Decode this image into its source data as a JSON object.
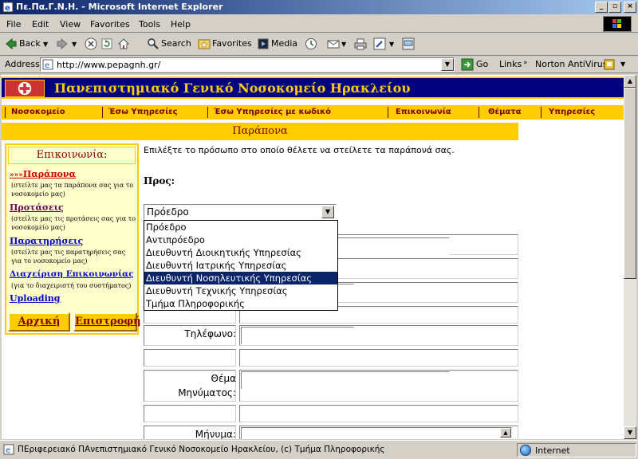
{
  "window": {
    "title": "Πε.Πα.Γ.Ν.Η. - Microsoft Internet Explorer"
  },
  "menubar": {
    "items": [
      "File",
      "Edit",
      "View",
      "Favorites",
      "Tools",
      "Help"
    ]
  },
  "toolbar": {
    "back": "Back",
    "search": "Search",
    "favorites": "Favorites",
    "media": "Media"
  },
  "address": {
    "label": "Address",
    "url": "http://www.pepagnh.gr/",
    "go": "Go",
    "links": "Links",
    "norton": "Norton AntiVirus"
  },
  "site": {
    "banner_title": "Πανεπιστημιακό Γενικό Νοσοκομείο Ηρακλείου",
    "nav": [
      "Νοσοκομείο",
      "Έσω Υπηρεσίες",
      "Έσω Υπηρεσίες με κωδικό",
      "Επικοινωνία",
      "Θέματα",
      "Υπηρεσίες"
    ],
    "page_header": "Παράπονα"
  },
  "sidebar": {
    "title": "Επικοινωνία:",
    "items": [
      {
        "arrow": "»»»",
        "label": "Παράπονα",
        "desc": "(στείλτε μας τα παράπονα σας για το νοσοκομείο μας)"
      },
      {
        "label": "Προτάσεις",
        "desc": "(στείλτε μας τις προτάσεις σας για το νοσοκομείο μας)"
      },
      {
        "label": "Παρατηρήσεις",
        "desc": "(στείλτε μας τις παρατηρήσεις σας για το νοσοκομείο μας)"
      },
      {
        "label": "Διαχείριση Επικοινωνίας",
        "desc": "(για το διαχειριστή του συστήματος)"
      },
      {
        "label": "Uploading"
      }
    ],
    "home_button": "Αρχική",
    "return_button": "Επιστροφή"
  },
  "form": {
    "intro": "Επιλέξτε το πρόσωπο στο οποίο θέλετε να στείλετε τα παράπονά σας.",
    "to_label": "Προς:",
    "selected": "Πρόεδρο",
    "options": [
      "Πρόεδρο",
      "Αντιπρόεδρο",
      "Διευθυντή Διοικητικής Υπηρεσίας",
      "Διευθυντή Ιατρικής Υπηρεσίας",
      "Διευθυντή Νοσηλευτικής Υπηρεσίας",
      "Διευθυντή Τεχνικής Υπηρεσίας",
      "Τμήμα Πληροφορικής"
    ],
    "highlighted_option": "Διευθυντή Νοσηλευτικής Υπηρεσίας",
    "phone_label": "Τηλέφωνο:",
    "subject_label_1": "Θέμα",
    "subject_label_2": "Μηνύματος:",
    "message_label": "Μήνυμα:"
  },
  "status": {
    "text": "ΠΕριφερειακό ΠΑνεπιστημιακό Γενικό Νοσοκομείο Ηρακλείου, (c) Τμήμα Πληροφορικής",
    "zone": "Internet"
  }
}
